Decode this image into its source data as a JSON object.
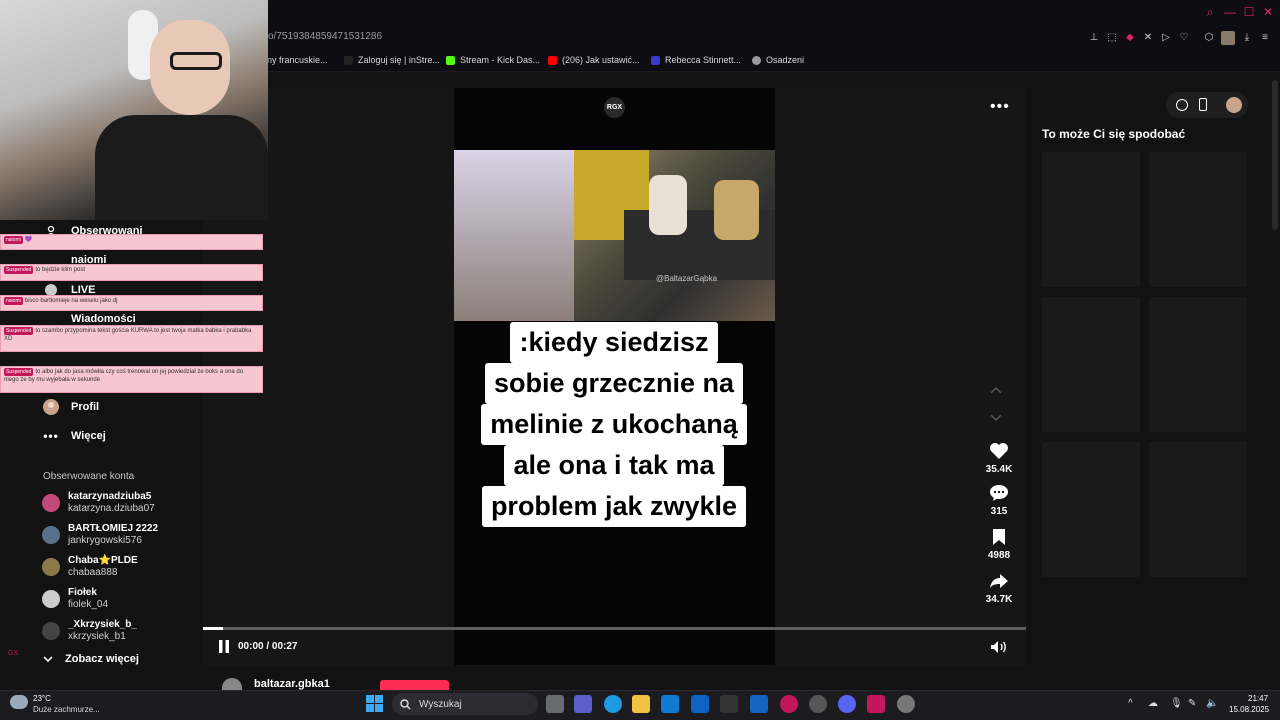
{
  "browser": {
    "url": "o/7519384859471531286",
    "bookmarks": [
      {
        "label": "any francuskie...",
        "color": "#444444"
      },
      {
        "label": "Zaloguj się | inStre...",
        "color": "#222222"
      },
      {
        "label": "Stream - Kick Das...",
        "color": "#53fc18"
      },
      {
        "label": "(206) Jak ustawić...",
        "color": "#ff0000"
      },
      {
        "label": "Rebecca Stinnett...",
        "color": "#3b3bc8"
      },
      {
        "label": "Osadzeni",
        "color": "#9a9a9a"
      }
    ]
  },
  "sidebar": {
    "nav": [
      {
        "label": "Obserwowani",
        "icon": "person-icon"
      },
      {
        "label": "naiomi",
        "icon": "people-icon"
      },
      {
        "label": "LIVE",
        "icon": "live-icon"
      },
      {
        "label": "Wiadomości",
        "icon": "message-icon"
      },
      {
        "label": "Profil",
        "icon": "avatar-icon"
      },
      {
        "label": "Więcej",
        "icon": "more-icon"
      }
    ],
    "following_title": "Obserwowane konta",
    "accounts": [
      {
        "name": "katarzynadziuba5",
        "handle": "katarzyna.dziuba07",
        "color": "#c44a7a"
      },
      {
        "name": "BARTŁOMIEJ 2222",
        "handle": "jankrygowski576",
        "color": "#5a6f8c"
      },
      {
        "name": "Chaba⭐PLDE",
        "handle": "chabaa888",
        "color": "#8a7a4a"
      },
      {
        "name": "Fiołek",
        "handle": "fiolek_04",
        "color": "#cccccc"
      },
      {
        "name": "_Xkrzysiek_b_",
        "handle": "xkrzysiek_b1",
        "color": "#444444"
      }
    ],
    "see_more": "Zobacz więcej"
  },
  "chat": {
    "messages": [
      {
        "user": "naiomi",
        "text": "💜"
      },
      {
        "user": "Suspended",
        "text": "to będzie klim post"
      },
      {
        "user": "naiomi",
        "text": "bisco bartłomieje na weselu jako dj"
      },
      {
        "user": "Suspended",
        "text": "to szambo przypomina tekst gościa KURWA to jest twoja matka babka i prababka XD"
      },
      {
        "user": "Suspended",
        "text": "to albo jak do jasa mówiła czy coś trenowal on jej powiedział że boks a ona do niego że by mu wyjebała w sekunde"
      }
    ]
  },
  "player": {
    "channel_badge": "RGX",
    "watermark": "@BaltazarGąbka",
    "caption_lines": [
      ":kiedy siedzisz",
      "sobie grzecznie na",
      "melinie z ukochaną",
      "ale ona i tak ma",
      "problem jak zwykle"
    ],
    "likes": "35.4K",
    "comments": "315",
    "saves": "4988",
    "shares": "34.7K",
    "time": "00:00 / 00:27",
    "progress": 0.024,
    "author": "baltazar.gbka1"
  },
  "right": {
    "title": "To może Ci się spodobać"
  },
  "taskbar": {
    "temp": "23°C",
    "weather": "Duże zachmurze...",
    "search_placeholder": "Wyszukaj",
    "time": "21:47",
    "date": "15.08.2025"
  }
}
